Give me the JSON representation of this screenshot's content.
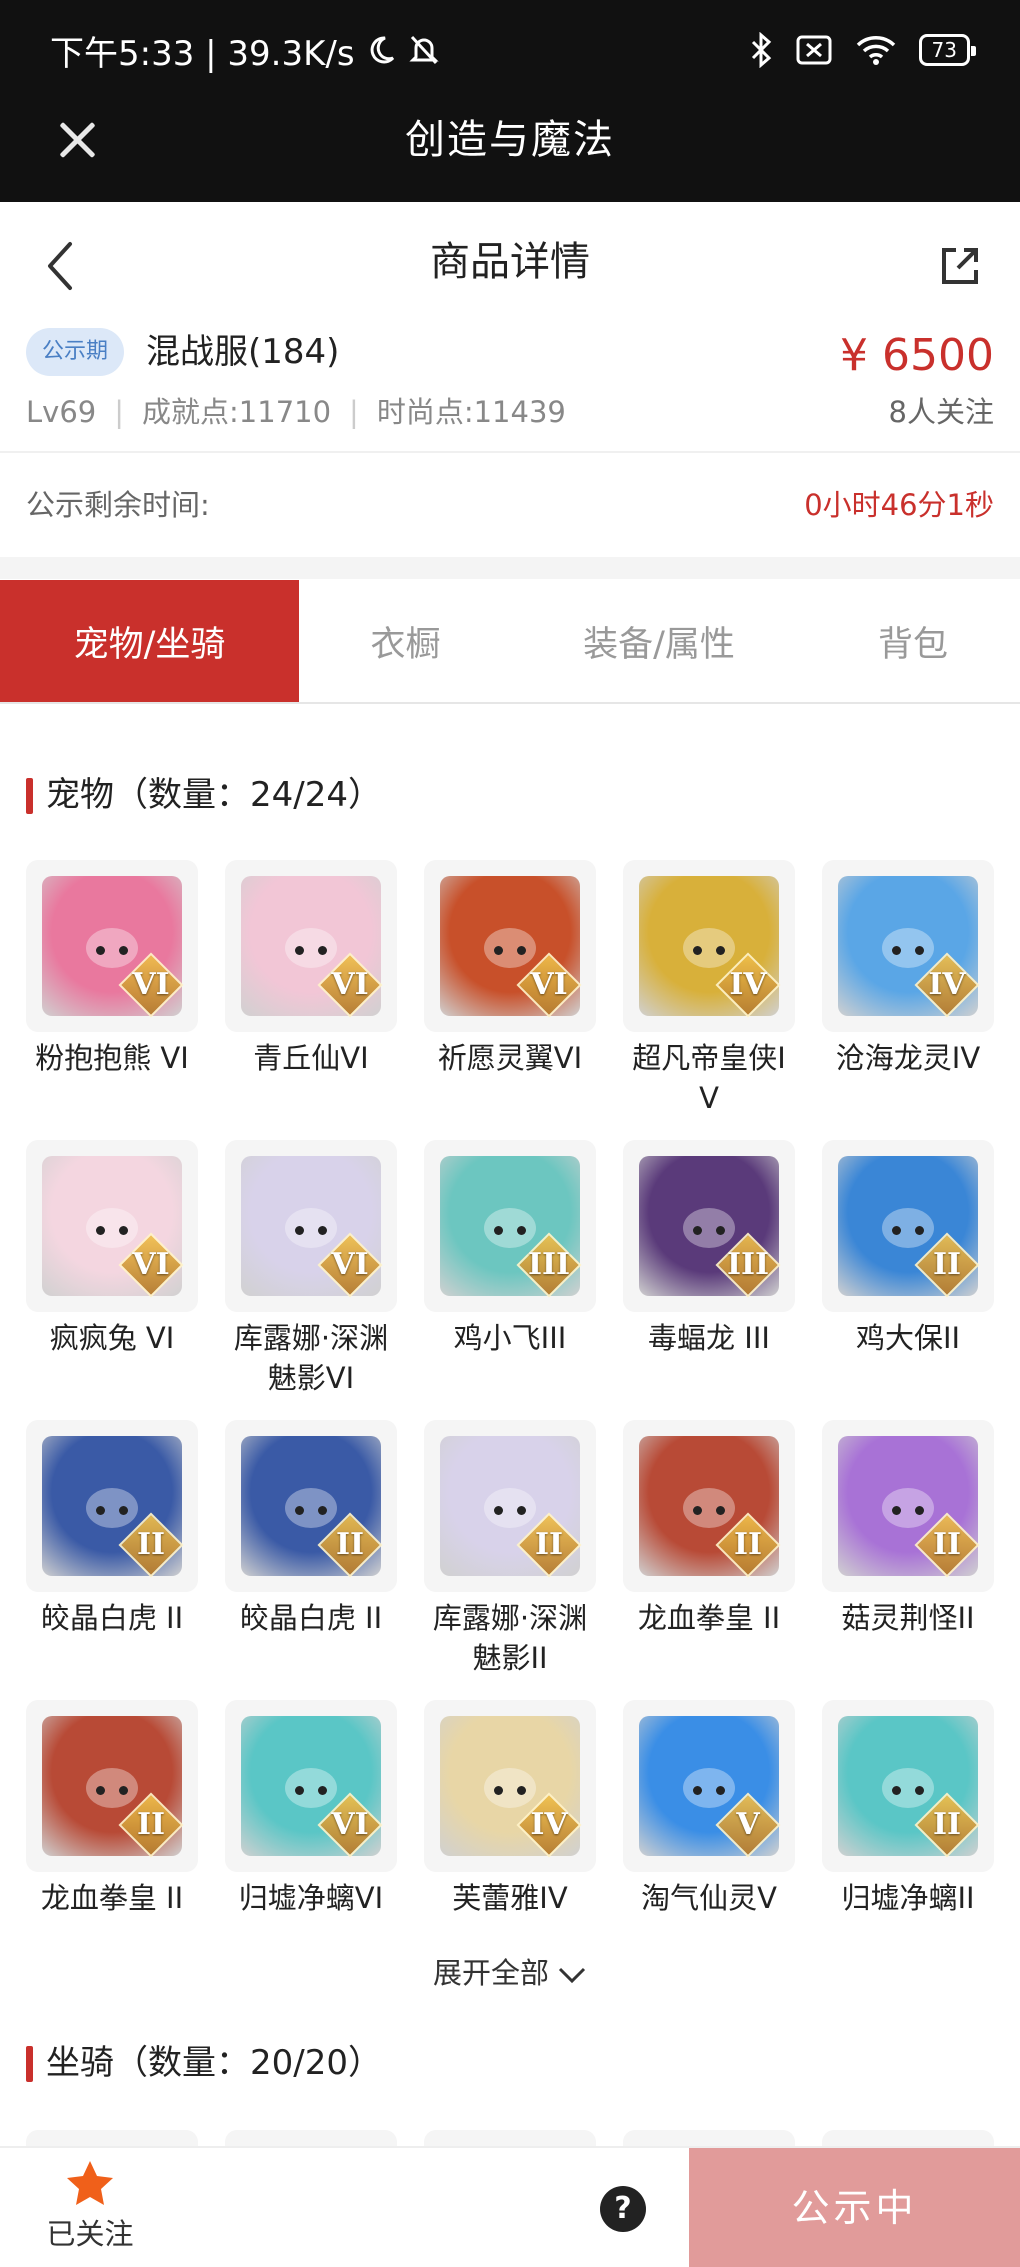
{
  "status_bar": {
    "time_speed": "下午5:33 | 39.3K/s",
    "battery": "73",
    "icons": [
      "moon-icon",
      "bell-off-icon",
      "bluetooth-icon",
      "sim-off-icon",
      "wifi-icon",
      "battery-icon"
    ]
  },
  "app_bar": {
    "title": "创造与魔法"
  },
  "nav": {
    "title": "商品详情"
  },
  "product": {
    "badge": "公示期",
    "server": "混战服(184)",
    "level": "Lv69",
    "achievement": "成就点:11710",
    "fashion": "时尚点:11439",
    "price": "¥ 6500",
    "followers": "8人关注"
  },
  "remain": {
    "label": "公示剩余时间:",
    "value": "0小时46分1秒"
  },
  "tabs": [
    {
      "label": "宠物/坐骑",
      "active": true
    },
    {
      "label": "衣橱",
      "active": false
    },
    {
      "label": "装备/属性",
      "active": false
    },
    {
      "label": "背包",
      "active": false
    }
  ],
  "pets_section": {
    "title": "宠物（数量：24/24）"
  },
  "pets": [
    {
      "name": "粉抱抱熊 VI",
      "tier": "VI",
      "color": "#e9789e"
    },
    {
      "name": "青丘仙VI",
      "tier": "VI",
      "color": "#f2c6d6"
    },
    {
      "name": "祈愿灵翼VI",
      "tier": "VI",
      "color": "#c8502a"
    },
    {
      "name": "超凡帝皇侠IV",
      "tier": "IV",
      "color": "#d8b03a"
    },
    {
      "name": "沧海龙灵IV",
      "tier": "IV",
      "color": "#5aa6e6"
    },
    {
      "name": "疯疯兔 VI",
      "tier": "VI",
      "color": "#f4d6e0"
    },
    {
      "name": "库露娜·深渊魅影VI",
      "tier": "VI",
      "color": "#d8d2ea"
    },
    {
      "name": "鸡小飞III",
      "tier": "III",
      "color": "#6cc6c0"
    },
    {
      "name": "毒蝠龙 III",
      "tier": "III",
      "color": "#5a3a7a"
    },
    {
      "name": "鸡大保II",
      "tier": "II",
      "color": "#3a86d6"
    },
    {
      "name": "皎晶白虎 II",
      "tier": "II",
      "color": "#3a5aa6"
    },
    {
      "name": "皎晶白虎 II",
      "tier": "II",
      "color": "#3a5aa6"
    },
    {
      "name": "库露娜·深渊魅影II",
      "tier": "II",
      "color": "#d8d2ea"
    },
    {
      "name": "龙血拳皇 II",
      "tier": "II",
      "color": "#b84a36"
    },
    {
      "name": "菇灵荆怪II",
      "tier": "II",
      "color": "#a872d6"
    },
    {
      "name": "龙血拳皇 II",
      "tier": "II",
      "color": "#b84a36"
    },
    {
      "name": "归墟净螭VI",
      "tier": "VI",
      "color": "#5ac6c6"
    },
    {
      "name": "芙蕾雅IV",
      "tier": "IV",
      "color": "#e8d6a6"
    },
    {
      "name": "淘气仙灵V",
      "tier": "V",
      "color": "#3a8ee6"
    },
    {
      "name": "归墟净螭II",
      "tier": "II",
      "color": "#5ac6c6"
    }
  ],
  "expand": {
    "label": "展开全部"
  },
  "mounts_section": {
    "title": "坐骑（数量：20/20）"
  },
  "bottom": {
    "followed_label": "已关注",
    "help": "?",
    "public_label": "公示中"
  },
  "colors": {
    "accent": "#c9302c",
    "public_button": "#e19b9a",
    "badge_bg": "#dce8f8",
    "star": "#f0601a"
  }
}
